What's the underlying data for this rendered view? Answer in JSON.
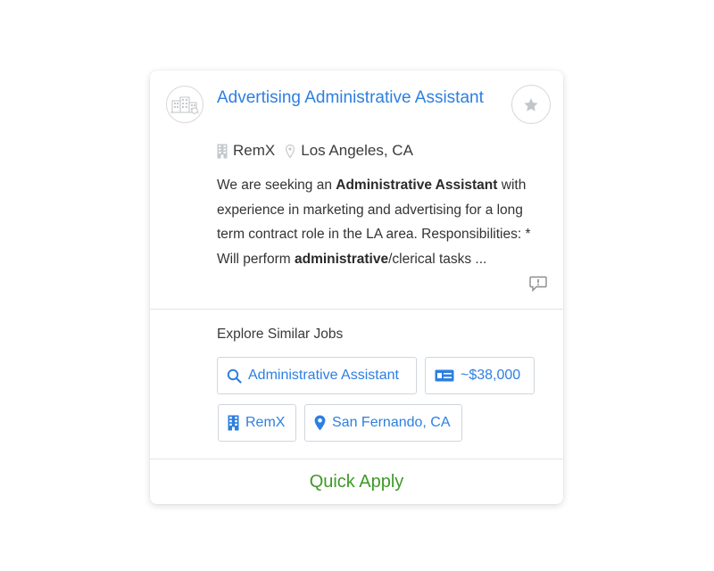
{
  "job": {
    "title": "Advertising Administrative Assistant",
    "company": "RemX",
    "location": "Los Angeles, CA",
    "description": {
      "p1": "We are seeking an ",
      "b1": "Administrative Assistant",
      "p2": " with experience in marketing and advertising for a long term contract role in the LA area. Responsibilities: * Will perform ",
      "b2": "administrative",
      "p3": "/clerical tasks ..."
    }
  },
  "icons": {
    "logo": "company-building-logo",
    "favorite": "star-icon",
    "company": "building-icon",
    "location": "map-pin-icon",
    "report": "report-flag-icon",
    "search": "search-icon",
    "salary": "money-bill-icon"
  },
  "explore": {
    "title": "Explore Similar Jobs",
    "chips": [
      {
        "label": "Administrative Assistant",
        "icon": "search-icon"
      },
      {
        "label": "~$38,000",
        "icon": "money-bill-icon"
      },
      {
        "label": "RemX",
        "icon": "building-icon"
      },
      {
        "label": "San Fernando, CA",
        "icon": "map-pin-icon"
      }
    ]
  },
  "actions": {
    "quick_apply": "Quick Apply"
  },
  "colors": {
    "link": "#2d7fe0",
    "apply": "#3d9a26",
    "border": "#cfd6de",
    "divider": "#e3e3e3"
  }
}
